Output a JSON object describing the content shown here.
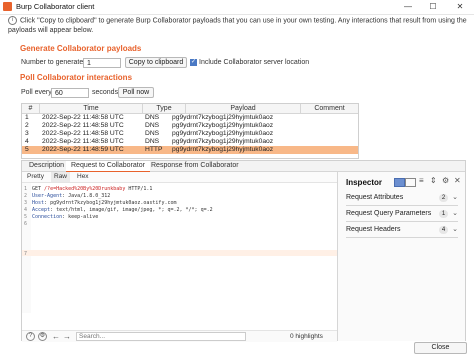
{
  "window": {
    "title": "Burp Collaborator client",
    "minimize": "—",
    "maximize": "☐",
    "close": "✕"
  },
  "info": {
    "text": "Click \"Copy to clipboard\" to generate Burp Collaborator payloads that you can use in your own testing. Any interactions that result from using the payloads will appear below."
  },
  "generate": {
    "heading": "Generate Collaborator payloads",
    "number_label": "Number to generate:",
    "number_value": "1",
    "copy_button": "Copy to clipboard",
    "include_label": "Include Collaborator server location"
  },
  "poll": {
    "heading": "Poll Collaborator interactions",
    "poll_every_label": "Poll every",
    "poll_every_value": "60",
    "seconds_label": "seconds",
    "poll_now_button": "Poll now"
  },
  "table": {
    "headers": [
      "#",
      "Time",
      "Type",
      "Payload",
      "Comment"
    ],
    "rows": [
      {
        "num": "1",
        "time": "2022-Sep-22 11:48:58 UTC",
        "type": "DNS",
        "payload": "pg9ydrnt7kzybog1j29hyjmtuk0aoz",
        "comment": ""
      },
      {
        "num": "2",
        "time": "2022-Sep-22 11:48:58 UTC",
        "type": "DNS",
        "payload": "pg9ydrnt7kzybog1j29hyjmtuk0aoz",
        "comment": ""
      },
      {
        "num": "3",
        "time": "2022-Sep-22 11:48:58 UTC",
        "type": "DNS",
        "payload": "pg9ydrnt7kzybog1j29hyjmtuk0aoz",
        "comment": ""
      },
      {
        "num": "4",
        "time": "2022-Sep-22 11:48:58 UTC",
        "type": "DNS",
        "payload": "pg9ydrnt7kzybog1j29hyjmtuk0aoz",
        "comment": ""
      },
      {
        "num": "5",
        "time": "2022-Sep-22 11:48:59 UTC",
        "type": "HTTP",
        "payload": "pg9ydrnt7kzybog1j29hyjmtuk0aoz",
        "comment": ""
      }
    ],
    "selected_row": "5"
  },
  "detail_tabs": [
    "Description",
    "Request to Collaborator",
    "Response from Collaborator"
  ],
  "active_detail_tab": "Request to Collaborator",
  "editor": {
    "subtabs": [
      "Pretty",
      "Raw",
      "Hex"
    ],
    "active_subtab": "Raw",
    "lines": [
      {
        "n": "1",
        "pre": "GET ",
        "red": "/?e=Hacked%20By%20Drunkbaby",
        "post": " HTTP/1.1"
      },
      {
        "n": "2",
        "key": "User-Agent",
        "val": ": Java/1.8.0_312"
      },
      {
        "n": "3",
        "key": "Host",
        "val": ": pg9ydrnt7kzybog1j29hyjmtuk0aoz.oastify.com"
      },
      {
        "n": "4",
        "key": "Accept",
        "val": ": text/html, image/gif, image/jpeg, *; q=.2, */*; q=.2"
      },
      {
        "n": "5",
        "key": "Connection",
        "val": ": keep-alive"
      },
      {
        "n": "6"
      },
      {
        "n": "7"
      }
    ],
    "search_placeholder": "Search...",
    "highlights": "0 highlights"
  },
  "inspector": {
    "title": "Inspector",
    "sections": [
      {
        "label": "Request Attributes",
        "count": "2"
      },
      {
        "label": "Request Query Parameters",
        "count": "1"
      },
      {
        "label": "Request Headers",
        "count": "4"
      }
    ]
  },
  "footer": {
    "close_button": "Close"
  },
  "colors": {
    "accent": "#e8622c",
    "selected_row": "#f8b888",
    "checkbox": "#4a79c4"
  }
}
